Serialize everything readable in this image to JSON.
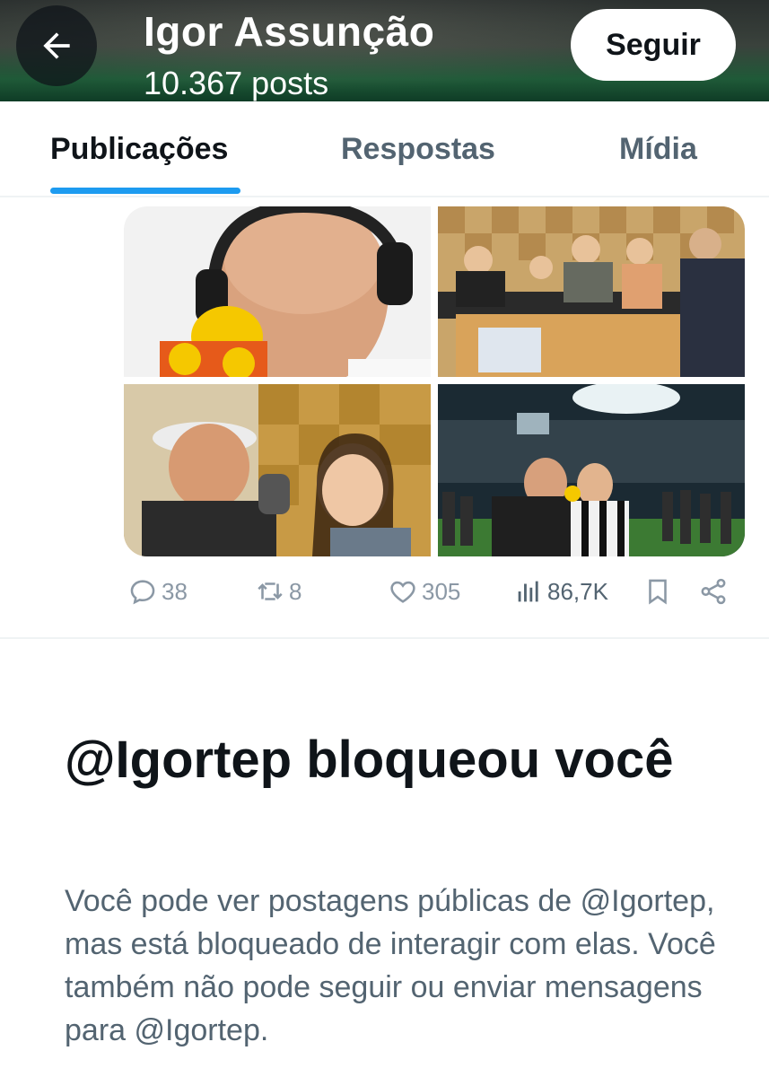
{
  "header": {
    "name": "Igor Assunção",
    "posts": "10.367 posts",
    "follow_label": "Seguir",
    "back_icon": "arrow-left-icon"
  },
  "tabs": [
    {
      "label": "Publicações",
      "active": true
    },
    {
      "label": "Respostas",
      "active": false
    },
    {
      "label": "Mídia",
      "active": false
    }
  ],
  "post": {
    "media_count": 4,
    "actions": {
      "replies": "38",
      "reposts": "8",
      "likes": "305",
      "views": "86,7K"
    }
  },
  "blocked": {
    "title": "@Igortep bloqueou você",
    "description": "Você pode ver postagens públicas de @Igortep, mas está bloqueado de interagir com elas. Você também não pode seguir ou enviar mensagens para @Igortep."
  },
  "colors": {
    "accent": "#1d9bf0",
    "text_primary": "#0f1419",
    "text_secondary": "#536471",
    "icon_gray": "#8b98a5"
  }
}
